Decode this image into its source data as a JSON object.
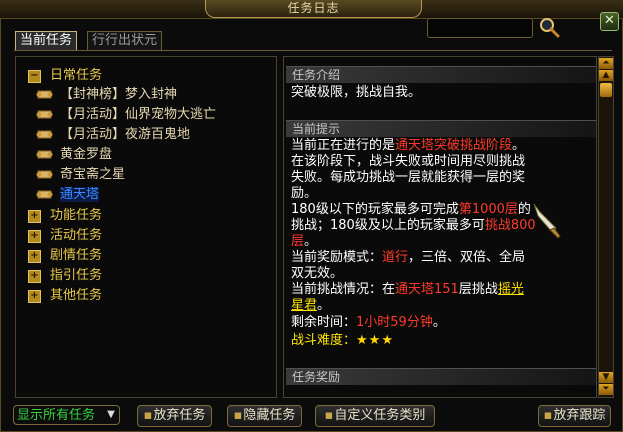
{
  "window": {
    "title": "任务日志"
  },
  "tabs": [
    {
      "label": "当前任务"
    },
    {
      "label": "行行出状元"
    }
  ],
  "tree": {
    "daily_category": "日常任务",
    "daily_quests": [
      "【封神榜】梦入封神",
      "【月活动】仙界宠物大逃亡",
      "【月活动】夜游百鬼地",
      "黄金罗盘",
      "奇宝斋之星",
      "通天塔"
    ],
    "collapsed_categories": [
      "功能任务",
      "活动任务",
      "剧情任务",
      "指引任务",
      "其他任务"
    ]
  },
  "detail": {
    "intro_header": "任务介绍",
    "intro_text": "突破极限，挑战自我。",
    "tips_header": "当前提示",
    "line1_prefix": "当前正在进行的是",
    "line1_red": "通天塔突破挑战阶段",
    "line1_suffix": "。",
    "line2": "在该阶段下，战斗失败或时间用尽则挑战",
    "line3": "失败。每成功挑战一层就能获得一层的奖",
    "line4": "励。",
    "line5_prefix": "180级以下的玩家最多可完成",
    "line5_red": "第1000层",
    "line5_suffix": "的",
    "line6_prefix": "挑战；180级及以上的玩家最多可",
    "line6_red": "挑战800",
    "line7_red": "层",
    "line7_suffix": "。",
    "line8_prefix": "当前奖励模式：",
    "line8_red": "道行",
    "line8_suffix": "，三倍、双倍、全局",
    "line9": "双无效。",
    "line10_prefix": "当前挑战情况：在",
    "line10_red": "通天塔151",
    "line10_mid": "层挑战",
    "line10_link": "摇光",
    "line11_link": "星君",
    "line11_suffix": "。",
    "time_label": "剩余时间：",
    "time_value": "1小时59分钟",
    "time_suffix": "。",
    "difficulty_label": "战斗难度：",
    "difficulty_stars": "★★★",
    "difficulty_rating": 3,
    "reward_header": "任务奖励"
  },
  "bottom": {
    "filter_value": "显示所有任务",
    "abandon_label": "放弃任务",
    "hide_label": "隐藏任务",
    "custom_label": "自定义任务类别",
    "untrack_label": "放弃跟踪"
  }
}
